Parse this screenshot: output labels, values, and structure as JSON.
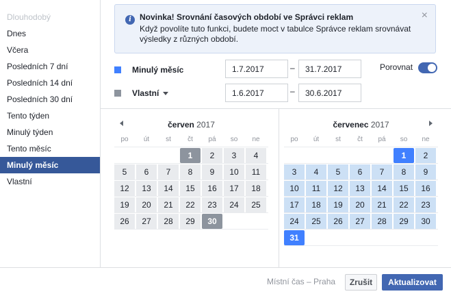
{
  "colors": {
    "accent": "#4267b2",
    "sidebar_active": "#365899",
    "primary_swatch": "#4080ff",
    "compare_swatch": "#8d949e",
    "blue_range": "#cce0f5",
    "gray_range": "#e9ebee"
  },
  "sidebar": {
    "items": [
      {
        "label": "Dlouhodobý"
      },
      {
        "label": "Dnes"
      },
      {
        "label": "Včera"
      },
      {
        "label": "Posledních 7 dní"
      },
      {
        "label": "Posledních 14 dní"
      },
      {
        "label": "Posledních 30 dní"
      },
      {
        "label": "Tento týden"
      },
      {
        "label": "Minulý týden"
      },
      {
        "label": "Tento měsíc"
      },
      {
        "label": "Minulý měsíc"
      },
      {
        "label": "Vlastní"
      }
    ],
    "active_index": 9
  },
  "notice": {
    "icon": "info-icon",
    "icon_glyph": "i",
    "title": "Novinka! Srovnání časových období ve Správci reklam",
    "body": "Když povolíte tuto funkci, budete moct v tabulce Správce reklam srovnávat výsledky z různých období.",
    "close_glyph": "×"
  },
  "primary_range": {
    "label": "Minulý měsíc",
    "start": "1.7.2017",
    "end": "31.7.2017",
    "dash": "–"
  },
  "compare_range": {
    "label": "Vlastní",
    "start": "1.6.2017",
    "end": "30.6.2017",
    "dash": "–"
  },
  "compare": {
    "label": "Porovnat",
    "enabled": true
  },
  "weekdays": [
    "po",
    "út",
    "st",
    "čt",
    "pá",
    "so",
    "ne"
  ],
  "calendars": [
    {
      "month": "červen",
      "year": "2017",
      "first_weekday": 3,
      "days": 30,
      "selected_start": 1,
      "selected_end": 30,
      "style": "gray"
    },
    {
      "month": "červenec",
      "year": "2017",
      "first_weekday": 5,
      "days": 31,
      "selected_start": 1,
      "selected_end": 31,
      "style": "blue"
    }
  ],
  "footer": {
    "timezone": "Místní čas – Praha",
    "cancel_label": "Zrušit",
    "update_label": "Aktualizovat"
  }
}
